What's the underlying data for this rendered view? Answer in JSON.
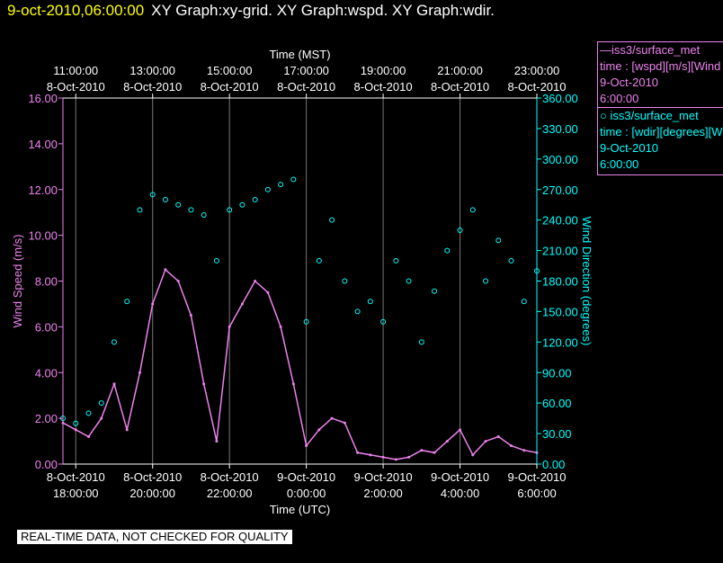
{
  "header": {
    "date": "9-oct-2010,06:00:00",
    "graphs": "XY Graph:xy-grid.  XY Graph:wspd.  XY Graph:wdir."
  },
  "legend": {
    "speed": {
      "line1": "—iss3/surface_met",
      "line2": "time : [wspd][m/s][Wind",
      "line3": "9-Oct-2010",
      "line4": "6:00:00"
    },
    "direction": {
      "line1": "○ iss3/surface_met",
      "line2": "time : [wdir][degrees][W",
      "line3": "9-Oct-2010",
      "line4": "6:00:00"
    }
  },
  "note": "REAL-TIME DATA, NOT CHECKED FOR QUALITY",
  "colors": {
    "speed": "#ee82ee",
    "direction": "#00ffff",
    "header_date": "#ffff00",
    "axis": "#ffffff"
  },
  "chart_data": {
    "type": "line",
    "top_axis": {
      "title": "Time (MST)",
      "ticks": [
        {
          "hour": 11,
          "time": "11:00:00",
          "date": "8-Oct-2010"
        },
        {
          "hour": 13,
          "time": "13:00:00",
          "date": "8-Oct-2010"
        },
        {
          "hour": 15,
          "time": "15:00:00",
          "date": "8-Oct-2010"
        },
        {
          "hour": 17,
          "time": "17:00:00",
          "date": "8-Oct-2010"
        },
        {
          "hour": 19,
          "time": "19:00:00",
          "date": "8-Oct-2010"
        },
        {
          "hour": 21,
          "time": "21:00:00",
          "date": "8-Oct-2010"
        },
        {
          "hour": 23,
          "time": "23:00:00",
          "date": "8-Oct-2010"
        }
      ]
    },
    "bottom_axis": {
      "title": "Time (UTC)",
      "xlim": [
        "8-Oct-2010 17:40:00",
        "9-Oct-2010 06:00:00"
      ],
      "ticks": [
        {
          "hour": 18,
          "date": "8-Oct-2010",
          "time": "18:00:00"
        },
        {
          "hour": 20,
          "date": "8-Oct-2010",
          "time": "20:00:00"
        },
        {
          "hour": 22,
          "date": "8-Oct-2010",
          "time": "22:00:00"
        },
        {
          "hour": 24,
          "date": "9-Oct-2010",
          "time": "0:00:00"
        },
        {
          "hour": 26,
          "date": "9-Oct-2010",
          "time": "2:00:00"
        },
        {
          "hour": 28,
          "date": "9-Oct-2010",
          "time": "4:00:00"
        },
        {
          "hour": 30,
          "date": "9-Oct-2010",
          "time": "6:00:00"
        }
      ]
    },
    "left_axis": {
      "title": "Wind Speed (m/s)",
      "ylim": [
        0,
        16
      ],
      "ticks": [
        "0.00",
        "2.00",
        "4.00",
        "6.00",
        "8.00",
        "10.00",
        "12.00",
        "14.00",
        "16.00"
      ]
    },
    "right_axis": {
      "title": "Wind Direction (degrees)",
      "ylim": [
        0,
        360
      ],
      "ticks": [
        "0.00",
        "30.00",
        "60.00",
        "90.00",
        "120.00",
        "150.00",
        "180.00",
        "210.00",
        "240.00",
        "270.00",
        "300.00",
        "330.00",
        "360.00"
      ]
    },
    "grid": true,
    "series": [
      {
        "name": "iss3/surface_met time : [wspd][m/s]",
        "type": "line",
        "axis": "left",
        "x_utc": [
          "8-Oct-2010 17:40",
          "18:00",
          "18:20",
          "18:40",
          "19:00",
          "19:20",
          "19:40",
          "20:00",
          "20:20",
          "20:40",
          "21:00",
          "21:20",
          "21:40",
          "22:00",
          "22:20",
          "22:40",
          "23:00",
          "23:20",
          "23:40",
          "9-Oct-2010 00:00",
          "00:20",
          "00:40",
          "01:00",
          "01:20",
          "01:40",
          "02:00",
          "02:20",
          "02:40",
          "03:00",
          "03:20",
          "03:40",
          "04:00",
          "04:20",
          "04:40",
          "05:00",
          "05:20",
          "05:40",
          "06:00"
        ],
        "values": [
          1.8,
          1.5,
          1.2,
          2.0,
          3.5,
          1.5,
          4.0,
          7.0,
          8.5,
          8.0,
          6.5,
          3.5,
          1.0,
          6.0,
          7.0,
          8.0,
          7.5,
          6.0,
          3.5,
          0.8,
          1.5,
          2.0,
          1.8,
          0.5,
          0.4,
          0.3,
          0.2,
          0.3,
          0.6,
          0.5,
          1.0,
          1.5,
          0.4,
          1.0,
          1.2,
          0.8,
          0.6,
          0.5
        ]
      },
      {
        "name": "iss3/surface_met time : [wdir][degrees]",
        "type": "scatter",
        "axis": "right",
        "x_utc": [
          "8-Oct-2010 17:40",
          "18:00",
          "18:20",
          "18:40",
          "19:00",
          "19:20",
          "19:40",
          "20:00",
          "20:20",
          "20:40",
          "21:00",
          "21:20",
          "21:40",
          "22:00",
          "22:20",
          "22:40",
          "23:00",
          "23:20",
          "23:40",
          "9-Oct-2010 00:00",
          "00:20",
          "00:40",
          "01:00",
          "01:20",
          "01:40",
          "02:00",
          "02:20",
          "02:40",
          "03:00",
          "03:20",
          "03:40",
          "04:00",
          "04:20",
          "04:40",
          "05:00",
          "05:20",
          "05:40",
          "06:00"
        ],
        "values": [
          45,
          40,
          50,
          60,
          120,
          160,
          250,
          265,
          260,
          255,
          250,
          245,
          200,
          250,
          255,
          260,
          270,
          275,
          280,
          140,
          200,
          240,
          180,
          150,
          160,
          140,
          200,
          180,
          120,
          170,
          210,
          230,
          250,
          180,
          220,
          200,
          160,
          190
        ]
      }
    ]
  }
}
